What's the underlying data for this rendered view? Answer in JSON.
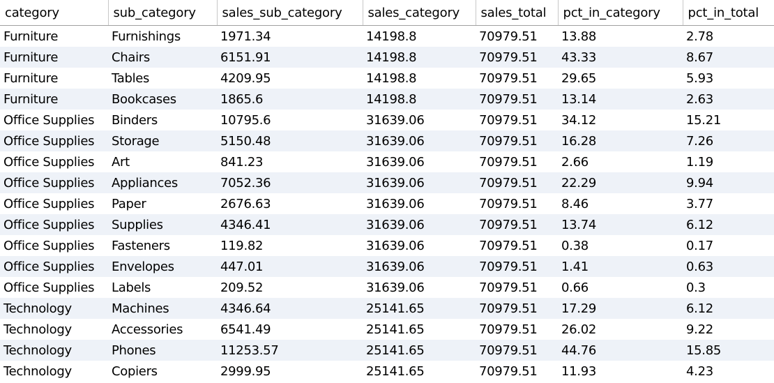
{
  "columns": [
    "category",
    "sub_category",
    "sales_sub_category",
    "sales_category",
    "sales_total",
    "pct_in_category",
    "pct_in_total"
  ],
  "rows": [
    [
      "Furniture",
      "Furnishings",
      "1971.34",
      "14198.8",
      "70979.51",
      "13.88",
      "2.78"
    ],
    [
      "Furniture",
      "Chairs",
      "6151.91",
      "14198.8",
      "70979.51",
      "43.33",
      "8.67"
    ],
    [
      "Furniture",
      "Tables",
      "4209.95",
      "14198.8",
      "70979.51",
      "29.65",
      "5.93"
    ],
    [
      "Furniture",
      "Bookcases",
      "1865.6",
      "14198.8",
      "70979.51",
      "13.14",
      "2.63"
    ],
    [
      "Office Supplies",
      "Binders",
      "10795.6",
      "31639.06",
      "70979.51",
      "34.12",
      "15.21"
    ],
    [
      "Office Supplies",
      "Storage",
      "5150.48",
      "31639.06",
      "70979.51",
      "16.28",
      "7.26"
    ],
    [
      "Office Supplies",
      "Art",
      "841.23",
      "31639.06",
      "70979.51",
      "2.66",
      "1.19"
    ],
    [
      "Office Supplies",
      "Appliances",
      "7052.36",
      "31639.06",
      "70979.51",
      "22.29",
      "9.94"
    ],
    [
      "Office Supplies",
      "Paper",
      "2676.63",
      "31639.06",
      "70979.51",
      "8.46",
      "3.77"
    ],
    [
      "Office Supplies",
      "Supplies",
      "4346.41",
      "31639.06",
      "70979.51",
      "13.74",
      "6.12"
    ],
    [
      "Office Supplies",
      "Fasteners",
      "119.82",
      "31639.06",
      "70979.51",
      "0.38",
      "0.17"
    ],
    [
      "Office Supplies",
      "Envelopes",
      "447.01",
      "31639.06",
      "70979.51",
      "1.41",
      "0.63"
    ],
    [
      "Office Supplies",
      "Labels",
      "209.52",
      "31639.06",
      "70979.51",
      "0.66",
      "0.3"
    ],
    [
      "Technology",
      "Machines",
      "4346.64",
      "25141.65",
      "70979.51",
      "17.29",
      "6.12"
    ],
    [
      "Technology",
      "Accessories",
      "6541.49",
      "25141.65",
      "70979.51",
      "26.02",
      "9.22"
    ],
    [
      "Technology",
      "Phones",
      "11253.57",
      "25141.65",
      "70979.51",
      "44.76",
      "15.85"
    ],
    [
      "Technology",
      "Copiers",
      "2999.95",
      "25141.65",
      "70979.51",
      "11.93",
      "4.23"
    ]
  ],
  "colors": {
    "row_stripe": "#eef2f8",
    "header_separator": "#c8c8c8"
  }
}
